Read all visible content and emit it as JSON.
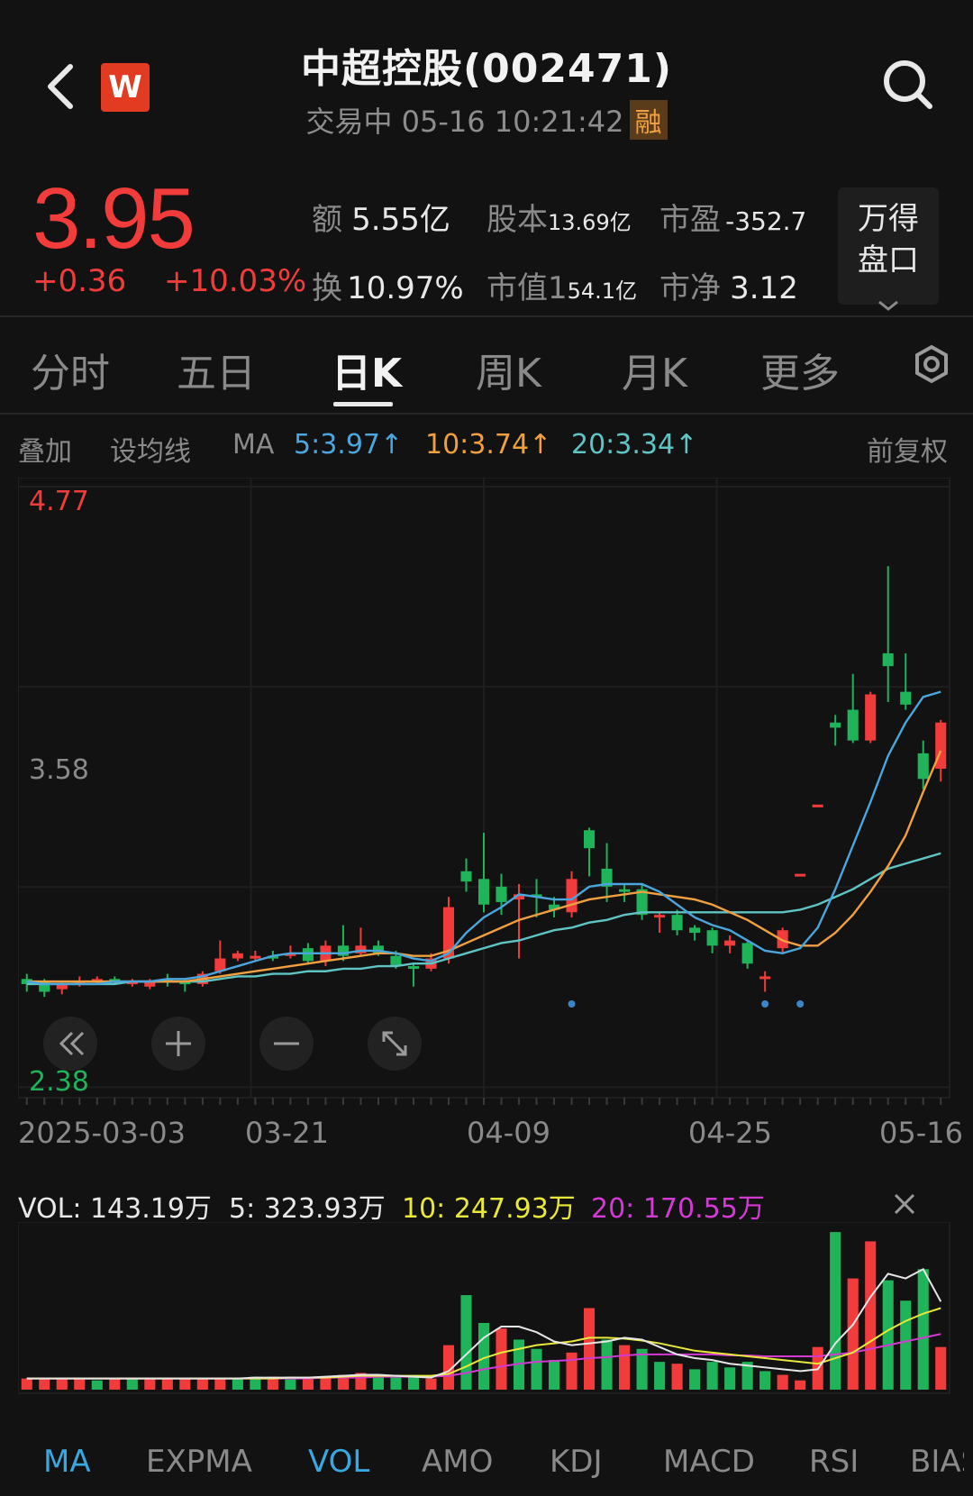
{
  "header": {
    "title": "中超控股(002471)",
    "status": "交易中 05-16 10:21:42",
    "badge": "融",
    "logo_text": "W"
  },
  "quote": {
    "price": "3.95",
    "change": "+0.36",
    "change_pct": "+10.03%",
    "stats": [
      {
        "label": "额",
        "value": "5.55亿"
      },
      {
        "label": "股本",
        "value": "13.69亿"
      },
      {
        "label": "市盈",
        "value": "-352.7"
      },
      {
        "label": "换",
        "value": "10.97%"
      },
      {
        "label": "市值",
        "value": "154.1亿",
        "value_big": "1",
        "value_small": "54.1亿"
      },
      {
        "label": "市净",
        "value": "3.12"
      }
    ],
    "wande_line1": "万得",
    "wande_line2": "盘口"
  },
  "tabs": [
    "分时",
    "五日",
    "日K",
    "周K",
    "月K",
    "更多"
  ],
  "active_tab": "日K",
  "ma_row": {
    "overlay": "叠加",
    "set_ma": "设均线",
    "ma": "MA",
    "ma5": "5:3.97↑",
    "ma10": "10:3.74↑",
    "ma20": "20:3.34↑",
    "adjust": "前复权"
  },
  "colors": {
    "up": "#f23c3c",
    "down": "#1fb35a",
    "ma5": "#4aa6dc",
    "ma10": "#f0a040",
    "ma20": "#5fc4c4",
    "vol_ma5": "#e6e6e6",
    "vol_ma10": "#e8e83a",
    "vol_ma20": "#d23ad2",
    "accent": "#3aa8e0"
  },
  "chart_data": {
    "type": "candlestick",
    "y_high_label": "4.77",
    "y_mid_label": "3.58",
    "y_low_label": "2.38",
    "ylim": [
      2.38,
      4.77
    ],
    "x_labels": [
      "2025-03-03",
      "03-21",
      "04-09",
      "04-25",
      "05-16"
    ],
    "candles": [
      {
        "o": 2.85,
        "h": 2.87,
        "l": 2.8,
        "c": 2.83
      },
      {
        "o": 2.84,
        "h": 2.85,
        "l": 2.78,
        "c": 2.8
      },
      {
        "o": 2.81,
        "h": 2.84,
        "l": 2.79,
        "c": 2.83
      },
      {
        "o": 2.83,
        "h": 2.86,
        "l": 2.82,
        "c": 2.84
      },
      {
        "o": 2.84,
        "h": 2.86,
        "l": 2.83,
        "c": 2.85
      },
      {
        "o": 2.85,
        "h": 2.86,
        "l": 2.83,
        "c": 2.84
      },
      {
        "o": 2.84,
        "h": 2.85,
        "l": 2.82,
        "c": 2.84
      },
      {
        "o": 2.82,
        "h": 2.85,
        "l": 2.81,
        "c": 2.84
      },
      {
        "o": 2.85,
        "h": 2.87,
        "l": 2.82,
        "c": 2.84
      },
      {
        "o": 2.84,
        "h": 2.85,
        "l": 2.8,
        "c": 2.83
      },
      {
        "o": 2.83,
        "h": 2.88,
        "l": 2.82,
        "c": 2.87
      },
      {
        "o": 2.88,
        "h": 3.0,
        "l": 2.87,
        "c": 2.93
      },
      {
        "o": 2.93,
        "h": 2.96,
        "l": 2.92,
        "c": 2.95
      },
      {
        "o": 2.93,
        "h": 2.96,
        "l": 2.92,
        "c": 2.94
      },
      {
        "o": 2.94,
        "h": 2.96,
        "l": 2.92,
        "c": 2.93
      },
      {
        "o": 2.94,
        "h": 2.98,
        "l": 2.93,
        "c": 2.95
      },
      {
        "o": 2.97,
        "h": 2.99,
        "l": 2.91,
        "c": 2.92
      },
      {
        "o": 2.92,
        "h": 3.0,
        "l": 2.9,
        "c": 2.98
      },
      {
        "o": 2.98,
        "h": 3.06,
        "l": 2.92,
        "c": 2.94
      },
      {
        "o": 2.95,
        "h": 3.05,
        "l": 2.94,
        "c": 2.98
      },
      {
        "o": 2.98,
        "h": 3.0,
        "l": 2.94,
        "c": 2.95
      },
      {
        "o": 2.94,
        "h": 2.96,
        "l": 2.89,
        "c": 2.9
      },
      {
        "o": 2.9,
        "h": 2.91,
        "l": 2.82,
        "c": 2.89
      },
      {
        "o": 2.89,
        "h": 2.95,
        "l": 2.88,
        "c": 2.93
      },
      {
        "o": 2.93,
        "h": 3.17,
        "l": 2.91,
        "c": 3.13
      },
      {
        "o": 3.27,
        "h": 3.32,
        "l": 3.19,
        "c": 3.23
      },
      {
        "o": 3.24,
        "h": 3.42,
        "l": 3.11,
        "c": 3.14
      },
      {
        "o": 3.21,
        "h": 3.26,
        "l": 3.1,
        "c": 3.15
      },
      {
        "o": 3.16,
        "h": 3.22,
        "l": 2.93,
        "c": 3.18
      },
      {
        "o": 3.18,
        "h": 3.24,
        "l": 3.09,
        "c": 3.17
      },
      {
        "o": 3.14,
        "h": 3.17,
        "l": 3.09,
        "c": 3.12
      },
      {
        "o": 3.11,
        "h": 3.27,
        "l": 3.09,
        "c": 3.24
      },
      {
        "o": 3.43,
        "h": 3.44,
        "l": 3.25,
        "c": 3.36
      },
      {
        "o": 3.28,
        "h": 3.38,
        "l": 3.15,
        "c": 3.21
      },
      {
        "o": 3.2,
        "h": 3.22,
        "l": 3.15,
        "c": 3.19
      },
      {
        "o": 3.2,
        "h": 3.22,
        "l": 3.08,
        "c": 3.1
      },
      {
        "o": 3.09,
        "h": 3.11,
        "l": 3.03,
        "c": 3.1
      },
      {
        "o": 3.1,
        "h": 3.12,
        "l": 3.02,
        "c": 3.04
      },
      {
        "o": 3.05,
        "h": 3.06,
        "l": 3.0,
        "c": 3.03
      },
      {
        "o": 3.04,
        "h": 3.05,
        "l": 2.95,
        "c": 2.98
      },
      {
        "o": 2.98,
        "h": 3.02,
        "l": 2.95,
        "c": 3.0
      },
      {
        "o": 2.99,
        "h": 3.0,
        "l": 2.89,
        "c": 2.91
      },
      {
        "o": 2.86,
        "h": 2.88,
        "l": 2.8,
        "c": 2.86
      },
      {
        "o": 2.97,
        "h": 3.05,
        "l": 2.95,
        "c": 3.04
      },
      {
        "o": 3.26,
        "h": 3.26,
        "l": 3.26,
        "c": 3.26
      },
      {
        "o": 3.53,
        "h": 3.53,
        "l": 3.53,
        "c": 3.53
      },
      {
        "o": 3.85,
        "h": 3.88,
        "l": 3.76,
        "c": 3.83
      },
      {
        "o": 3.9,
        "h": 4.04,
        "l": 3.77,
        "c": 3.78
      },
      {
        "o": 3.78,
        "h": 3.97,
        "l": 3.77,
        "c": 3.96
      },
      {
        "o": 4.12,
        "h": 4.46,
        "l": 3.93,
        "c": 4.07
      },
      {
        "o": 3.97,
        "h": 4.12,
        "l": 3.9,
        "c": 3.92
      },
      {
        "o": 3.73,
        "h": 3.78,
        "l": 3.59,
        "c": 3.63
      },
      {
        "o": 3.67,
        "h": 3.86,
        "l": 3.62,
        "c": 3.85
      }
    ],
    "ma5": [
      2.84,
      2.83,
      2.83,
      2.83,
      2.83,
      2.84,
      2.84,
      2.84,
      2.85,
      2.85,
      2.86,
      2.88,
      2.9,
      2.92,
      2.94,
      2.95,
      2.95,
      2.95,
      2.95,
      2.96,
      2.96,
      2.95,
      2.93,
      2.92,
      2.95,
      3.03,
      3.09,
      3.13,
      3.18,
      3.17,
      3.16,
      3.16,
      3.21,
      3.22,
      3.22,
      3.22,
      3.19,
      3.14,
      3.09,
      3.06,
      3.04,
      3.0,
      2.96,
      2.95,
      2.97,
      3.05,
      3.2,
      3.37,
      3.54,
      3.72,
      3.85,
      3.95,
      3.97
    ],
    "ma10": [
      2.84,
      2.84,
      2.84,
      2.84,
      2.84,
      2.84,
      2.84,
      2.84,
      2.84,
      2.84,
      2.85,
      2.86,
      2.87,
      2.88,
      2.89,
      2.9,
      2.91,
      2.92,
      2.93,
      2.94,
      2.95,
      2.95,
      2.94,
      2.94,
      2.96,
      2.99,
      3.02,
      3.05,
      3.08,
      3.1,
      3.12,
      3.14,
      3.16,
      3.17,
      3.18,
      3.19,
      3.18,
      3.17,
      3.16,
      3.14,
      3.11,
      3.08,
      3.04,
      3.0,
      2.98,
      2.98,
      3.03,
      3.1,
      3.19,
      3.29,
      3.41,
      3.58,
      3.74
    ],
    "ma20": [
      2.83,
      2.83,
      2.83,
      2.83,
      2.83,
      2.83,
      2.84,
      2.84,
      2.84,
      2.84,
      2.84,
      2.85,
      2.86,
      2.86,
      2.87,
      2.87,
      2.88,
      2.88,
      2.89,
      2.89,
      2.9,
      2.9,
      2.91,
      2.91,
      2.93,
      2.95,
      2.97,
      2.99,
      3.0,
      3.02,
      3.04,
      3.05,
      3.07,
      3.08,
      3.1,
      3.11,
      3.11,
      3.11,
      3.11,
      3.11,
      3.11,
      3.11,
      3.11,
      3.11,
      3.12,
      3.14,
      3.17,
      3.2,
      3.24,
      3.28,
      3.3,
      3.32,
      3.34
    ],
    "signal_dots": [
      31,
      42,
      44
    ]
  },
  "chart_controls": [
    "rewind-icon",
    "zoom-in-icon",
    "zoom-out-icon",
    "expand-icon"
  ],
  "volume": {
    "vol": "VOL: 143.19万",
    "v5": "5: 323.93万",
    "v10": "10: 247.93万",
    "v20": "20: 170.55万",
    "bars": [
      12,
      12,
      12,
      12,
      10,
      12,
      12,
      12,
      12,
      12,
      12,
      12,
      12,
      14,
      14,
      14,
      12,
      14,
      16,
      18,
      14,
      14,
      14,
      12,
      48,
      102,
      72,
      66,
      54,
      44,
      32,
      40,
      88,
      54,
      48,
      44,
      30,
      28,
      22,
      30,
      24,
      30,
      20,
      16,
      10,
      46,
      170,
      120,
      160,
      118,
      96,
      130,
      46
    ],
    "bar_up": [
      1,
      1,
      1,
      1,
      0,
      1,
      0,
      1,
      1,
      1,
      1,
      1,
      0,
      0,
      1,
      0,
      1,
      1,
      1,
      1,
      0,
      0,
      0,
      1,
      1,
      0,
      0,
      1,
      0,
      0,
      0,
      1,
      1,
      0,
      1,
      0,
      0,
      1,
      0,
      0,
      0,
      0,
      0,
      1,
      1,
      1,
      0,
      1,
      1,
      0,
      0,
      0,
      1
    ],
    "ma5": [
      12,
      12,
      12,
      12,
      12,
      12,
      12,
      12,
      12,
      12,
      12,
      12,
      12,
      13,
      13,
      13,
      13,
      14,
      15,
      16,
      16,
      15,
      14,
      13,
      20,
      38,
      56,
      68,
      68,
      62,
      52,
      48,
      50,
      52,
      56,
      54,
      46,
      38,
      34,
      32,
      28,
      26,
      24,
      22,
      20,
      22,
      50,
      70,
      100,
      125,
      120,
      130,
      95
    ],
    "ma10": [
      12,
      12,
      12,
      12,
      12,
      12,
      12,
      12,
      12,
      12,
      12,
      12,
      12,
      12,
      12,
      13,
      13,
      13,
      14,
      15,
      15,
      15,
      15,
      15,
      17,
      25,
      34,
      40,
      44,
      48,
      50,
      52,
      56,
      56,
      55,
      53,
      50,
      46,
      42,
      40,
      38,
      36,
      34,
      32,
      30,
      28,
      34,
      40,
      52,
      64,
      74,
      82,
      88
    ],
    "ma20": [
      12,
      12,
      12,
      12,
      12,
      12,
      12,
      12,
      12,
      12,
      12,
      12,
      12,
      12,
      12,
      12,
      12,
      13,
      13,
      13,
      14,
      14,
      14,
      14,
      15,
      18,
      22,
      25,
      28,
      30,
      31,
      32,
      34,
      35,
      37,
      38,
      38,
      38,
      38,
      38,
      37,
      37,
      36,
      36,
      36,
      36,
      38,
      40,
      44,
      48,
      52,
      56,
      60
    ]
  },
  "indicator_tabs": [
    "MA",
    "EXPMA",
    "VOL",
    "AMO",
    "KDJ",
    "MACD",
    "RSI",
    "BIAS"
  ]
}
